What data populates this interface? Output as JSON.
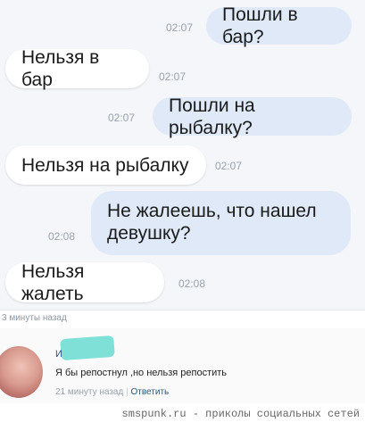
{
  "messages": [
    {
      "text": "Пошли в бар?",
      "time": "02:07",
      "side": "out"
    },
    {
      "text": "Нельзя в бар",
      "time": "02:07",
      "side": "in"
    },
    {
      "text": "Пошли на рыбалку?",
      "time": "02:07",
      "side": "out"
    },
    {
      "text": "Нельзя на рыбалку",
      "time": "02:07",
      "side": "in"
    },
    {
      "text_line1": "Не жалеешь, что нашел",
      "text_line2": "девушку?",
      "time": "02:08",
      "side": "out"
    },
    {
      "text": "Нельзя жалеть",
      "time": "02:08",
      "side": "in"
    }
  ],
  "post_time": "3 минуты назад",
  "comment": {
    "author_initial": "И",
    "text": "Я бы репостнул ,но нельзя репостить",
    "time": "21 минуту назад",
    "separator": "|",
    "reply_label": "Ответить"
  },
  "watermark": "smspunk.ru - приколы социальных сетей"
}
